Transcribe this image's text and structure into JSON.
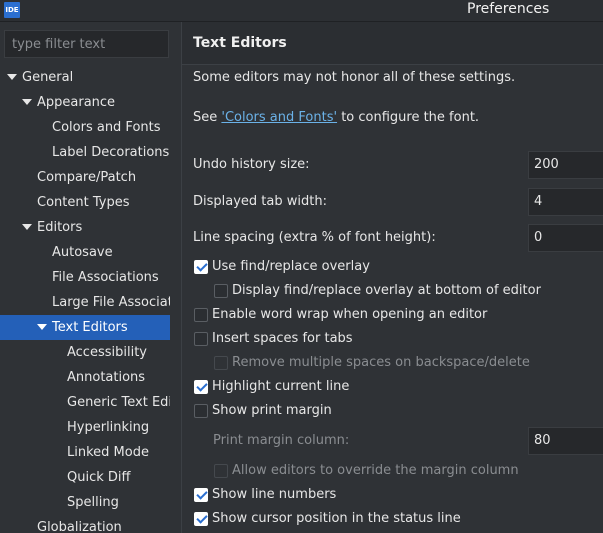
{
  "window": {
    "app_icon_text": "IDE",
    "title": "Preferences"
  },
  "filter": {
    "placeholder": "type filter text"
  },
  "tree": {
    "items": [
      "General",
      "Appearance",
      "Colors and Fonts",
      "Label Decorations",
      "Compare/Patch",
      "Content Types",
      "Editors",
      "Autosave",
      "File Associations",
      "Large File Associations",
      "Text Editors",
      "Accessibility",
      "Annotations",
      "Generic Text Editor",
      "Hyperlinking",
      "Linked Mode",
      "Quick Diff",
      "Spelling",
      "Globalization"
    ],
    "selected": "Text Editors"
  },
  "page": {
    "title": "Text Editors",
    "note": "Some editors may not honor all of these settings.",
    "see_prefix": "See ",
    "see_link": "'Colors and Fonts'",
    "see_suffix": " to configure the font.",
    "undo_label": "Undo history size:",
    "undo_value": "200",
    "tab_label": "Displayed tab width:",
    "tab_value": "4",
    "spacing_label": "Line spacing (extra % of font height):",
    "spacing_value": "0",
    "checks": {
      "find_overlay": {
        "label": "Use find/replace overlay",
        "checked": true
      },
      "overlay_bottom": {
        "label": "Display find/replace overlay at bottom of editor",
        "checked": false
      },
      "word_wrap": {
        "label": "Enable word wrap when opening an editor",
        "checked": false
      },
      "spaces_tabs": {
        "label": "Insert spaces for tabs",
        "checked": false
      },
      "remove_spaces": {
        "label": "Remove multiple spaces on backspace/delete",
        "checked": false,
        "disabled": true
      },
      "highlight_line": {
        "label": "Highlight current line",
        "checked": true
      },
      "print_margin": {
        "label": "Show print margin",
        "checked": false
      },
      "allow_override": {
        "label": "Allow editors to override the margin column",
        "checked": false,
        "disabled": true
      },
      "line_numbers": {
        "label": "Show line numbers",
        "checked": true
      },
      "cursor_position": {
        "label": "Show cursor position in the status line",
        "checked": true
      }
    },
    "margin_label": "Print margin column:",
    "margin_value": "80"
  }
}
